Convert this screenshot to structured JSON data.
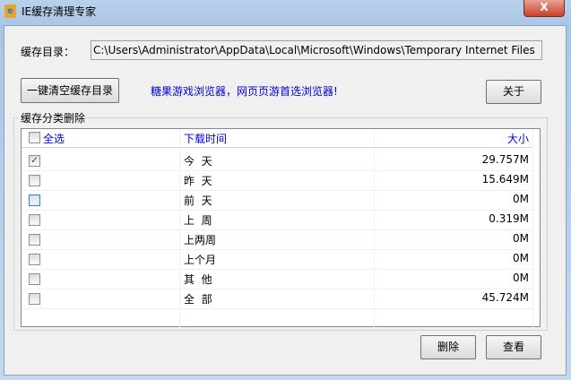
{
  "window": {
    "title": "IE缓存清理专家",
    "close": "X"
  },
  "cache_dir": {
    "label": "缓存目录：",
    "value": "C:\\Users\\Administrator\\AppData\\Local\\Microsoft\\Windows\\Temporary Internet Files"
  },
  "buttons": {
    "clear_all": "一键清空缓存目录",
    "about": "关于",
    "delete": "删除",
    "view": "查看"
  },
  "promo": "糖果游戏浏览器，网页页游首选浏览器!",
  "group_label": "缓存分类删除",
  "list": {
    "headers": {
      "select_all": "全选",
      "time": "下载时间",
      "size": "大小"
    },
    "rows": [
      {
        "time": "今  天",
        "size": "29.757M",
        "checked": true
      },
      {
        "time": "昨  天",
        "size": "15.649M",
        "checked": false
      },
      {
        "time": "前  天",
        "size": "0M",
        "checked": false
      },
      {
        "time": "上  周",
        "size": "0.319M",
        "checked": false
      },
      {
        "time": "上两周",
        "size": "0M",
        "checked": false
      },
      {
        "time": "上个月",
        "size": "0M",
        "checked": false
      },
      {
        "time": "其  他",
        "size": "0M",
        "checked": false
      },
      {
        "time": "全  部",
        "size": "45.724M",
        "checked": false
      }
    ]
  }
}
